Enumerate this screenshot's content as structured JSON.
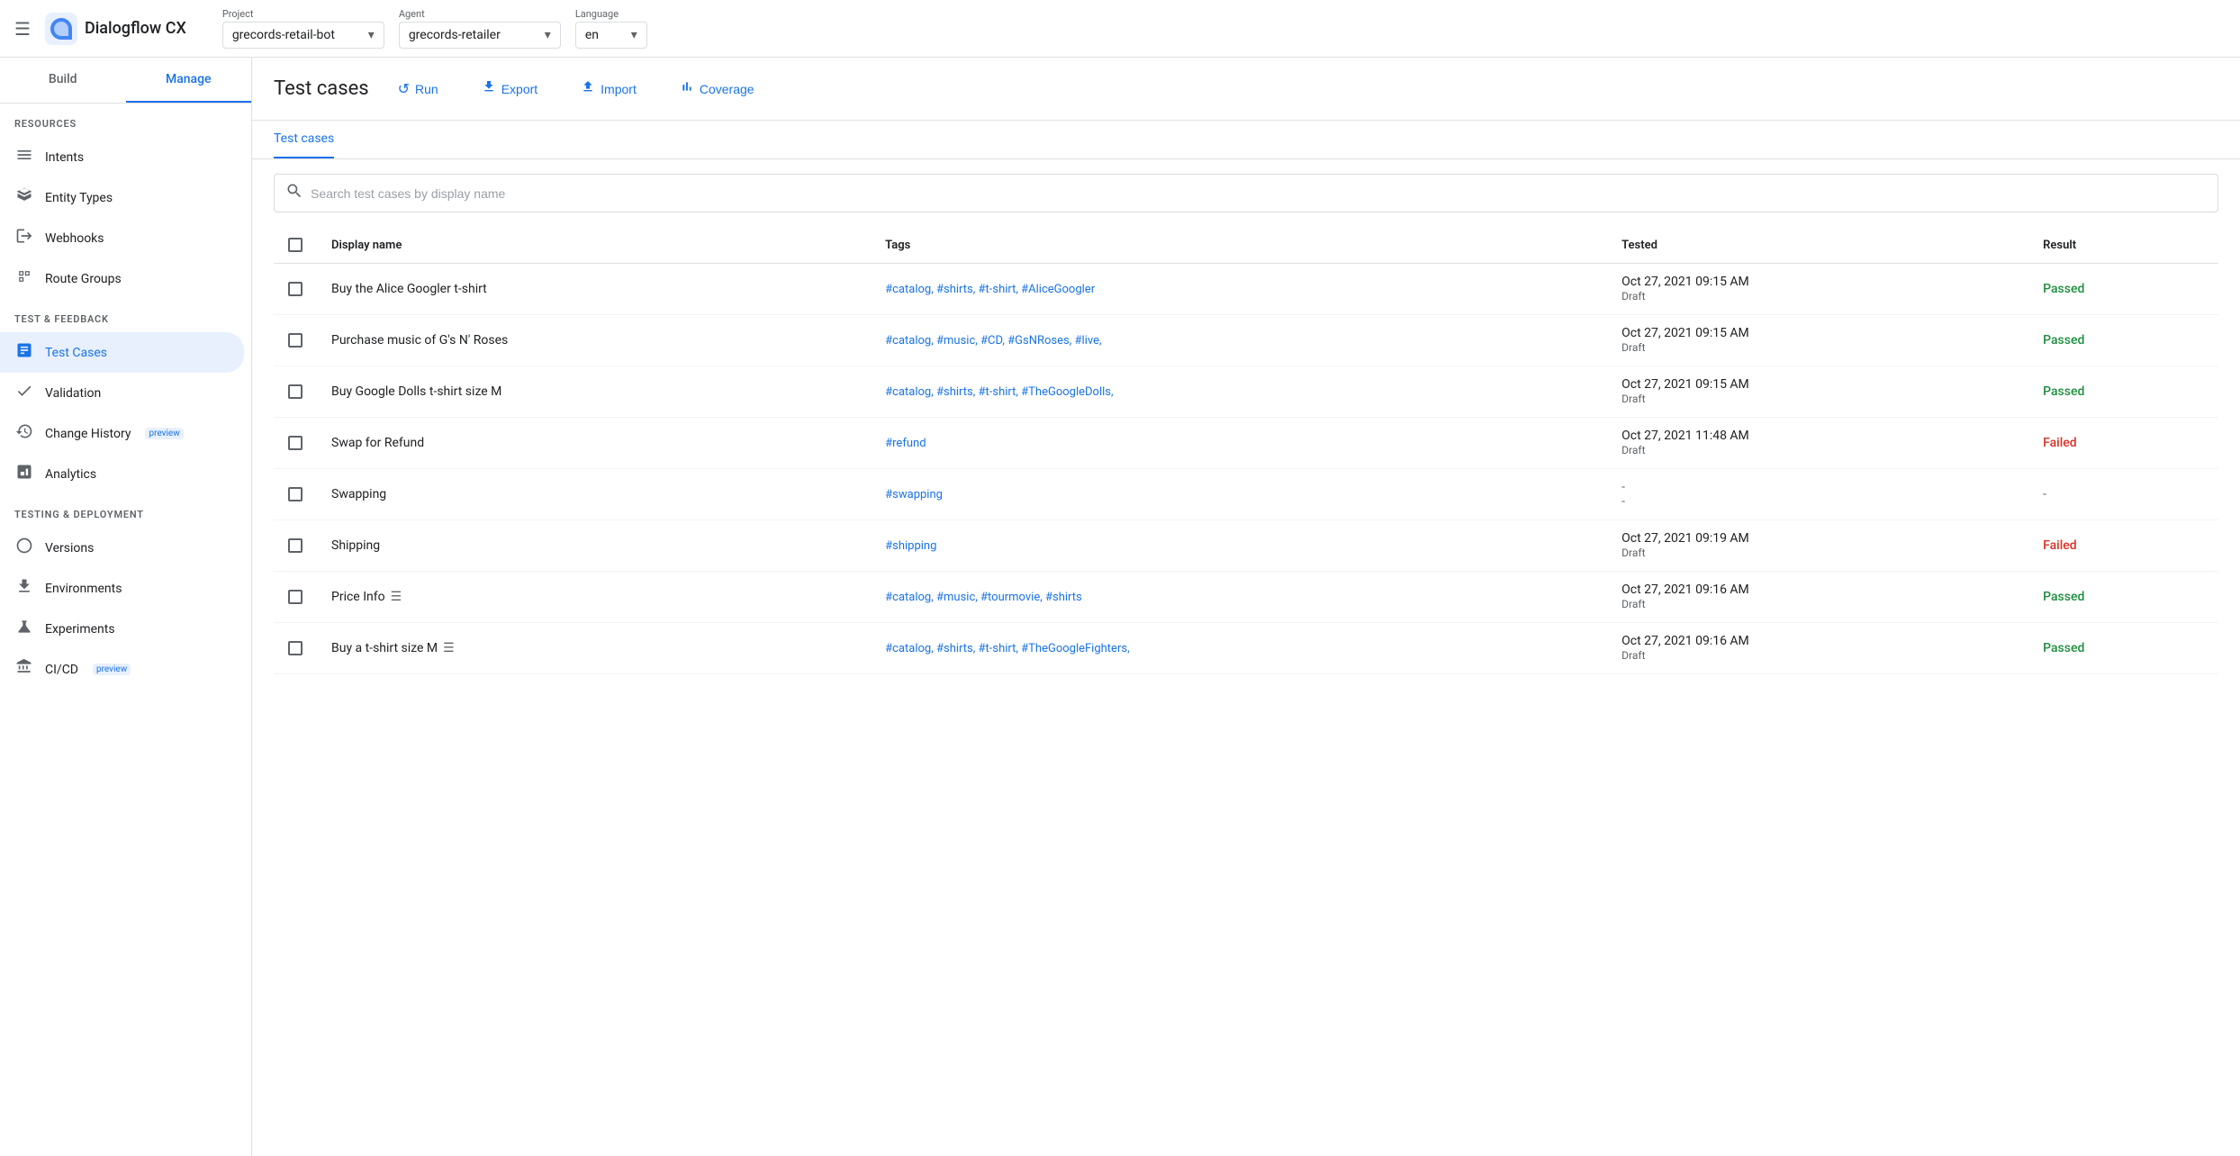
{
  "topbar": {
    "menu_icon": "☰",
    "app_name": "Dialogflow CX",
    "project_label": "Project",
    "project_value": "grecords-retail-bot",
    "agent_label": "Agent",
    "agent_value": "grecords-retailer",
    "language_label": "Language",
    "language_value": "en"
  },
  "sidebar": {
    "tab_build": "Build",
    "tab_manage": "Manage",
    "sections": [
      {
        "label": "RESOURCES",
        "items": [
          {
            "id": "intents",
            "icon": "☰",
            "text": "Intents",
            "active": false
          },
          {
            "id": "entity-types",
            "icon": "⬡",
            "text": "Entity Types",
            "active": false
          },
          {
            "id": "webhooks",
            "icon": "↗",
            "text": "Webhooks",
            "active": false
          },
          {
            "id": "route-groups",
            "icon": "↔",
            "text": "Route Groups",
            "active": false
          }
        ]
      },
      {
        "label": "TEST & FEEDBACK",
        "items": [
          {
            "id": "test-cases",
            "icon": "📋",
            "text": "Test Cases",
            "active": true
          },
          {
            "id": "validation",
            "icon": "✓",
            "text": "Validation",
            "active": false
          },
          {
            "id": "change-history",
            "icon": "🕐",
            "text": "Change History",
            "active": false,
            "badge": "preview"
          },
          {
            "id": "analytics",
            "icon": "📊",
            "text": "Analytics",
            "active": false
          }
        ]
      },
      {
        "label": "TESTING & DEPLOYMENT",
        "items": [
          {
            "id": "versions",
            "icon": "◇",
            "text": "Versions",
            "active": false
          },
          {
            "id": "environments",
            "icon": "⬇",
            "text": "Environments",
            "active": false
          },
          {
            "id": "experiments",
            "icon": "⚗",
            "text": "Experiments",
            "active": false
          },
          {
            "id": "cicd",
            "icon": "∞",
            "text": "CI/CD",
            "active": false,
            "badge": "preview"
          }
        ]
      }
    ]
  },
  "content": {
    "page_title": "Test cases",
    "header_buttons": [
      {
        "id": "run",
        "icon": "↺",
        "label": "Run"
      },
      {
        "id": "export",
        "icon": "⬇",
        "label": "Export"
      },
      {
        "id": "import",
        "icon": "⬆",
        "label": "Import"
      },
      {
        "id": "coverage",
        "icon": "▐",
        "label": "Coverage"
      }
    ],
    "tab_label": "Test cases",
    "search_placeholder": "Search test cases by display name",
    "table": {
      "columns": [
        "Display name",
        "Tags",
        "Tested",
        "Result"
      ],
      "rows": [
        {
          "id": 1,
          "display_name": "Buy the Alice Googler t-shirt",
          "has_icon": false,
          "tags": "#catalog, #shirts, #t-shirt, #AliceGoogler",
          "tested_date": "Oct 27, 2021 09:15 AM",
          "tested_status": "Draft",
          "result": "Passed",
          "result_type": "passed"
        },
        {
          "id": 2,
          "display_name": "Purchase music of G's N' Roses",
          "has_icon": false,
          "tags": "#catalog, #music, #CD, #GsNRoses, #live,",
          "tested_date": "Oct 27, 2021 09:15 AM",
          "tested_status": "Draft",
          "result": "Passed",
          "result_type": "passed"
        },
        {
          "id": 3,
          "display_name": "Buy Google Dolls t-shirt size M",
          "has_icon": false,
          "tags": "#catalog, #shirts, #t-shirt, #TheGoogleDolls,",
          "tested_date": "Oct 27, 2021 09:15 AM",
          "tested_status": "Draft",
          "result": "Passed",
          "result_type": "passed"
        },
        {
          "id": 4,
          "display_name": "Swap for Refund",
          "has_icon": false,
          "tags": "#refund",
          "tested_date": "Oct 27, 2021 11:48 AM",
          "tested_status": "Draft",
          "result": "Failed",
          "result_type": "failed"
        },
        {
          "id": 5,
          "display_name": "Swapping",
          "has_icon": false,
          "tags": "#swapping",
          "tested_date": "-",
          "tested_status": "-",
          "result": "-",
          "result_type": "dash"
        },
        {
          "id": 6,
          "display_name": "Shipping",
          "has_icon": false,
          "tags": "#shipping",
          "tested_date": "Oct 27, 2021 09:19 AM",
          "tested_status": "Draft",
          "result": "Failed",
          "result_type": "failed"
        },
        {
          "id": 7,
          "display_name": "Price Info",
          "has_icon": true,
          "tags": "#catalog, #music, #tourmovie, #shirts",
          "tested_date": "Oct 27, 2021 09:16 AM",
          "tested_status": "Draft",
          "result": "Passed",
          "result_type": "passed"
        },
        {
          "id": 8,
          "display_name": "Buy a t-shirt size M",
          "has_icon": true,
          "tags": "#catalog, #shirts, #t-shirt, #TheGoogleFighters,",
          "tested_date": "Oct 27, 2021 09:16 AM",
          "tested_status": "Draft",
          "result": "Passed",
          "result_type": "passed"
        }
      ]
    }
  },
  "colors": {
    "accent": "#1a73e8",
    "passed": "#1e8e3e",
    "failed": "#d93025"
  }
}
